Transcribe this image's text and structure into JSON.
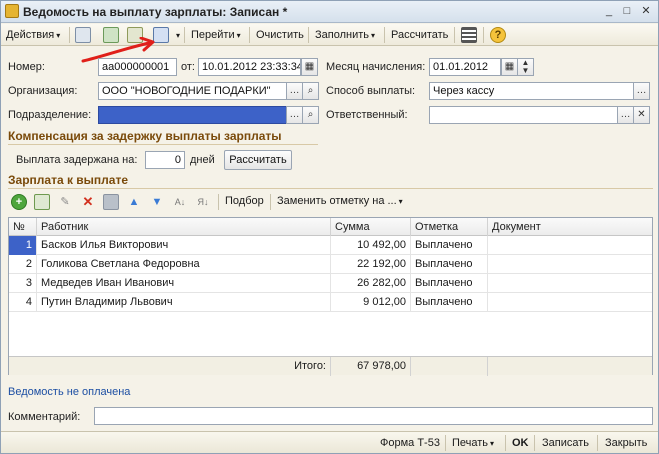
{
  "window": {
    "title": "Ведомость на выплату зарплаты: Записан *",
    "controls": [
      "_",
      "□",
      "✕"
    ]
  },
  "toolbar": {
    "actions_label": "Действия",
    "goto_label": "Перейти",
    "clear_label": "Очистить",
    "fill_label": "Заполнить",
    "calc_label": "Рассчитать",
    "help_icon": "?"
  },
  "form": {
    "number_label": "Номер:",
    "number_value": "аа000000001",
    "from_label": "от:",
    "date_value": "10.01.2012 23:33:34",
    "month_label": "Месяц начисления:",
    "month_value": "01.01.2012",
    "org_label": "Организация:",
    "org_value": "ООО \"НОВОГОДНИЕ ПОДАРКИ\"",
    "payment_label": "Способ выплаты:",
    "payment_value": "Через кассу",
    "dept_label": "Подразделение:",
    "dept_value": "",
    "responsible_label": "Ответственный:",
    "responsible_value": ""
  },
  "compensation": {
    "title": "Компенсация за задержку выплаты зарплаты",
    "delay_label": "Выплата задержана на:",
    "delay_value": "0",
    "days_label": "дней",
    "calc_button": "Рассчитать"
  },
  "salary": {
    "title": "Зарплата к выплате",
    "selection_label": "Подбор",
    "replace_label": "Заменить отметку на ...",
    "columns": [
      "№",
      "Работник",
      "Сумма",
      "Отметка",
      "Документ"
    ],
    "rows": [
      {
        "n": "1",
        "worker": "Басков Илья Викторович",
        "sum": "10 492,00",
        "mark": "Выплачено",
        "doc": ""
      },
      {
        "n": "2",
        "worker": "Голикова Светлана Федоровна",
        "sum": "22 192,00",
        "mark": "Выплачено",
        "doc": ""
      },
      {
        "n": "3",
        "worker": "Медведев Иван Иванович",
        "sum": "26 282,00",
        "mark": "Выплачено",
        "doc": ""
      },
      {
        "n": "4",
        "worker": "Путин Владимир Львович",
        "sum": "9 012,00",
        "mark": "Выплачено",
        "doc": ""
      }
    ],
    "total_label": "Итого:",
    "total_value": "67 978,00"
  },
  "status": {
    "not_paid_text": "Ведомость не оплачена",
    "comment_label": "Комментарий:",
    "comment_value": ""
  },
  "bottom": {
    "form_label": "Форма Т-53",
    "print_label": "Печать",
    "ok_label": "OK",
    "save_label": "Записать",
    "close_label": "Закрыть"
  },
  "colors": {
    "accent_blue": "#3d62c8",
    "section_brown": "#7a4a0a",
    "annotation_red": "#e0201a"
  }
}
